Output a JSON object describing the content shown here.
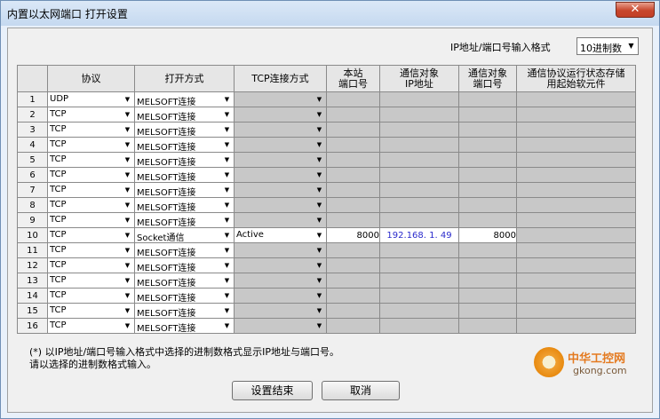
{
  "window": {
    "title": "内置以太网端口 打开设置",
    "close_label": "✕"
  },
  "format": {
    "label": "IP地址/端口号输入格式",
    "value": "10进制数"
  },
  "columns": [
    "",
    "协议",
    "打开方式",
    "TCP连接方式",
    "本站\n端口号",
    "通信对象\nIP地址",
    "通信对象\n端口号",
    "通信协议运行状态存储\n用起始软元件"
  ],
  "rows": [
    {
      "n": "1",
      "protocol": "UDP",
      "open": "MELSOFT连接",
      "tcp": "",
      "port": "",
      "ip": "",
      "rport": ""
    },
    {
      "n": "2",
      "protocol": "TCP",
      "open": "MELSOFT连接",
      "tcp": "",
      "port": "",
      "ip": "",
      "rport": ""
    },
    {
      "n": "3",
      "protocol": "TCP",
      "open": "MELSOFT连接",
      "tcp": "",
      "port": "",
      "ip": "",
      "rport": ""
    },
    {
      "n": "4",
      "protocol": "TCP",
      "open": "MELSOFT连接",
      "tcp": "",
      "port": "",
      "ip": "",
      "rport": ""
    },
    {
      "n": "5",
      "protocol": "TCP",
      "open": "MELSOFT连接",
      "tcp": "",
      "port": "",
      "ip": "",
      "rport": ""
    },
    {
      "n": "6",
      "protocol": "TCP",
      "open": "MELSOFT连接",
      "tcp": "",
      "port": "",
      "ip": "",
      "rport": ""
    },
    {
      "n": "7",
      "protocol": "TCP",
      "open": "MELSOFT连接",
      "tcp": "",
      "port": "",
      "ip": "",
      "rport": ""
    },
    {
      "n": "8",
      "protocol": "TCP",
      "open": "MELSOFT连接",
      "tcp": "",
      "port": "",
      "ip": "",
      "rport": ""
    },
    {
      "n": "9",
      "protocol": "TCP",
      "open": "MELSOFT连接",
      "tcp": "",
      "port": "",
      "ip": "",
      "rport": ""
    },
    {
      "n": "10",
      "protocol": "TCP",
      "open": "Socket通信",
      "tcp": "Active",
      "port": "8000",
      "ip": "192.168. 1. 49",
      "rport": "8000"
    },
    {
      "n": "11",
      "protocol": "TCP",
      "open": "MELSOFT连接",
      "tcp": "",
      "port": "",
      "ip": "",
      "rport": ""
    },
    {
      "n": "12",
      "protocol": "TCP",
      "open": "MELSOFT连接",
      "tcp": "",
      "port": "",
      "ip": "",
      "rport": ""
    },
    {
      "n": "13",
      "protocol": "TCP",
      "open": "MELSOFT连接",
      "tcp": "",
      "port": "",
      "ip": "",
      "rport": ""
    },
    {
      "n": "14",
      "protocol": "TCP",
      "open": "MELSOFT连接",
      "tcp": "",
      "port": "",
      "ip": "",
      "rport": ""
    },
    {
      "n": "15",
      "protocol": "TCP",
      "open": "MELSOFT连接",
      "tcp": "",
      "port": "",
      "ip": "",
      "rport": ""
    },
    {
      "n": "16",
      "protocol": "TCP",
      "open": "MELSOFT连接",
      "tcp": "",
      "port": "",
      "ip": "",
      "rport": ""
    }
  ],
  "note": {
    "line1": "(*) 以IP地址/端口号输入格式中选择的进制数格式显示IP地址与端口号。",
    "line2": "请以选择的进制数格式输入。"
  },
  "buttons": {
    "ok": "设置结束",
    "cancel": "取消"
  },
  "logo": {
    "cn": "中华工控网",
    "en": "gkong.com"
  }
}
